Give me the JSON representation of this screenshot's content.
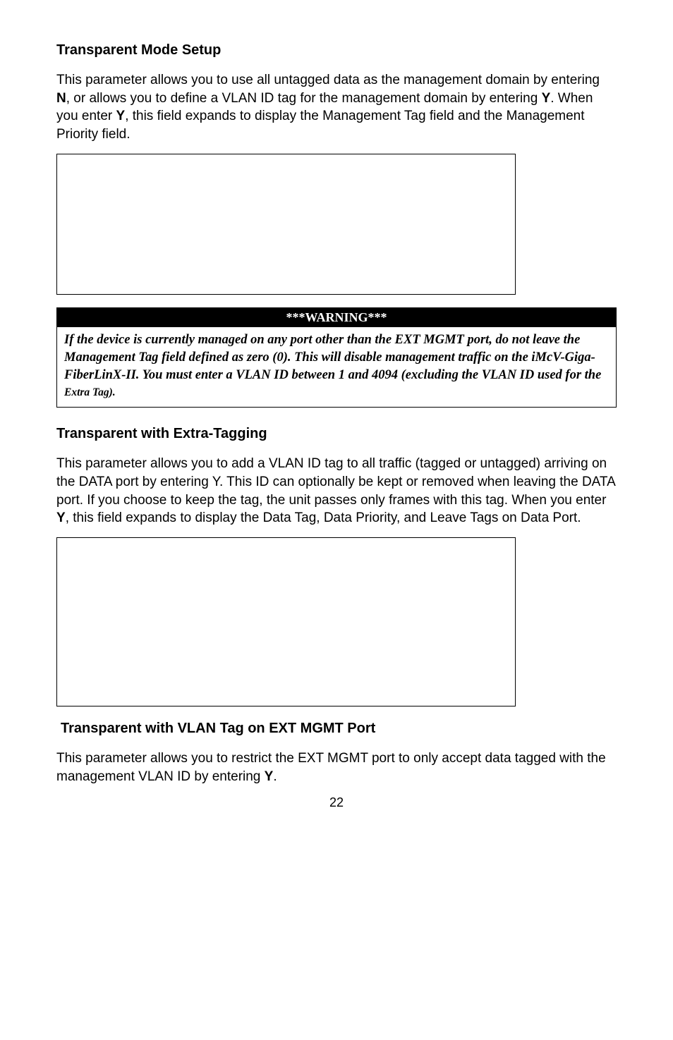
{
  "section1": {
    "heading": "Transparent Mode Setup",
    "para": [
      "This parameter allows you to use all untagged data as the management domain by entering ",
      "N",
      ", or allows you to define a VLAN ID tag for the management domain by entering ",
      "Y",
      ".  When you enter ",
      "Y",
      ", this field expands to display the Management Tag field and the Management Priority field."
    ]
  },
  "warning": {
    "header": "***WARNING***",
    "body": [
      "If the device is currently managed on any port other than the EXT MGMT port, do not leave the Management Tag field defined as zero (0).  This will disable management traffic on the iMcV-Giga-FiberLinX-II.  You must enter a VLAN ID between 1 and 4094 (excluding the VLAN ID used for the ",
      "Extra Tag)."
    ]
  },
  "section2": {
    "heading": "Transparent with Extra-Tagging",
    "para": [
      "This parameter allows you to add a VLAN ID tag to all traffic (tagged or untagged) arriving on the DATA port by entering Y.  This ID can optionally be kept or removed when leaving the DATA port.  If you choose to keep the tag, the unit passes only frames with this tag.  When you enter ",
      "Y",
      ", this field expands to display the Data Tag, Data Priority, and Leave Tags on Data Port."
    ]
  },
  "section3": {
    "heading": "Transparent with VLAN Tag on EXT MGMT Port",
    "para": [
      "This parameter allows you to restrict the EXT MGMT port to only accept data tagged with the management VLAN ID by entering ",
      "Y",
      "."
    ]
  },
  "pageNumber": "22"
}
